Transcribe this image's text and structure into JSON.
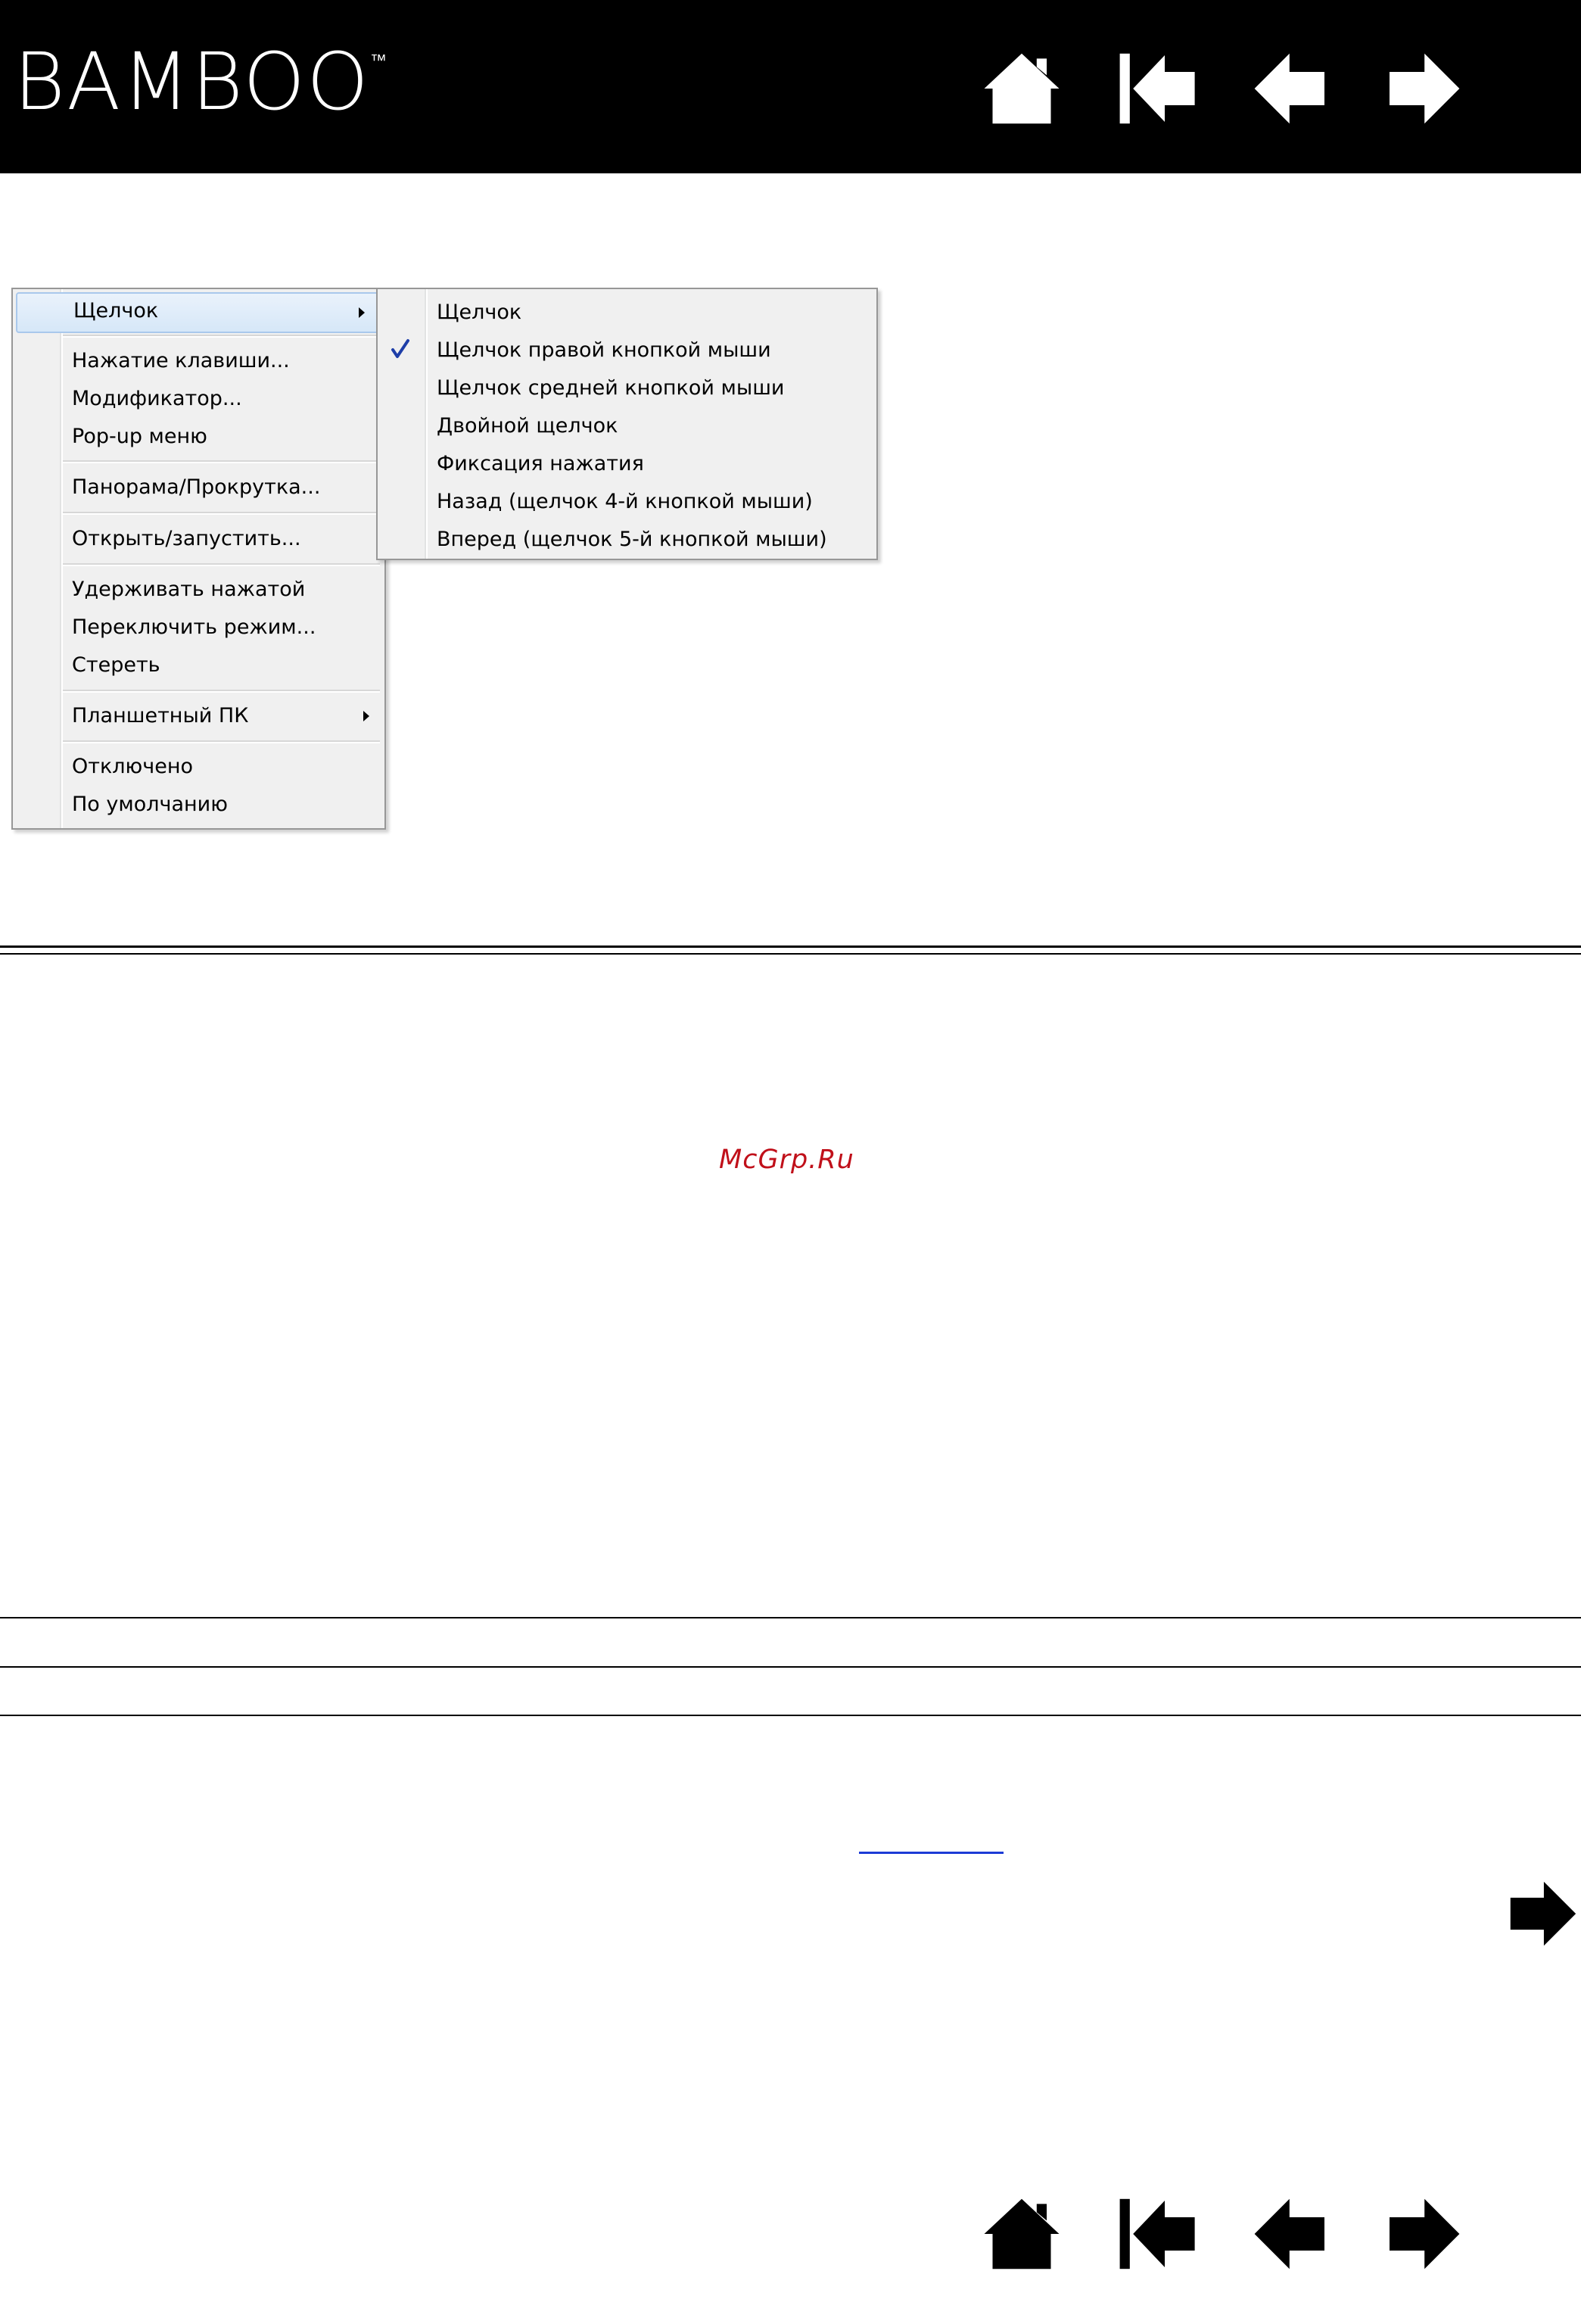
{
  "header": {
    "logo_text": "BAMBOO",
    "logo_tm": "™",
    "nav": {
      "home_icon": "home-icon",
      "first_icon": "first-page-icon",
      "prev_icon": "previous-page-icon",
      "next_icon": "next-page-icon"
    }
  },
  "main_menu": {
    "items": [
      {
        "label": "Щелчок",
        "submenu": true,
        "selected": true
      },
      {
        "label": "Нажатие клавиши..."
      },
      {
        "label": "Модификатор..."
      },
      {
        "label": "Pop-up меню"
      },
      {
        "label": "Панорама/Прокрутка..."
      },
      {
        "label": "Открыть/запустить..."
      },
      {
        "label": "Удерживать нажатой"
      },
      {
        "label": "Переключить режим..."
      },
      {
        "label": "Стереть"
      },
      {
        "label": "Планшетный ПК",
        "submenu": true
      },
      {
        "label": "Отключено"
      },
      {
        "label": "По умолчанию"
      }
    ]
  },
  "submenu": {
    "items": [
      {
        "label": "Щелчок"
      },
      {
        "label": "Щелчок правой кнопкой мыши",
        "checked": true
      },
      {
        "label": "Щелчок средней кнопкой мыши"
      },
      {
        "label": "Двойной щелчок"
      },
      {
        "label": "Фиксация нажатия"
      },
      {
        "label": "Назад (щелчок 4-й кнопкой мыши)"
      },
      {
        "label": "Вперед (щелчок 5-й кнопкой мыши)"
      }
    ]
  },
  "watermark": "McGrp.Ru",
  "colors": {
    "header_bg": "#000000",
    "watermark": "#c0101a",
    "link": "#1c3bd6",
    "menu_bg": "#f0f0f0",
    "check": "#1e3ea8"
  }
}
